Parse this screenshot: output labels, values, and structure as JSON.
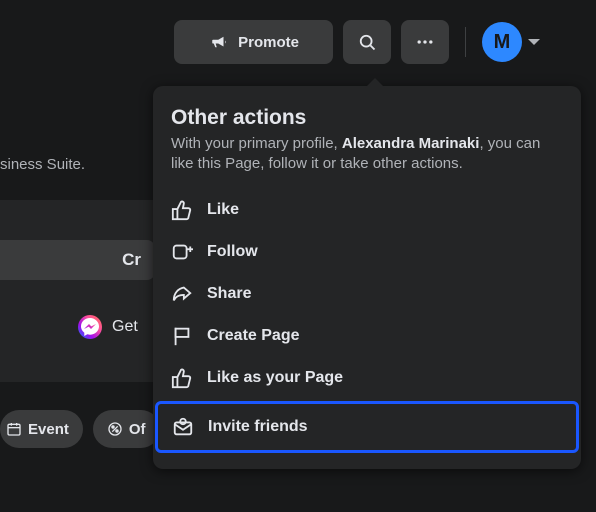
{
  "toolbar": {
    "promote_label": "Promote",
    "avatar_letter": "M"
  },
  "partial": {
    "suite_text": "siness Suite.",
    "center_btn": "Cr",
    "messenger_text": "Get",
    "chip_event": "Event",
    "chip_offers": "Of"
  },
  "dropdown": {
    "title": "Other actions",
    "sub_before": "With your primary profile, ",
    "profile_name": "Alexandra Marinaki",
    "sub_after": ", you can like this Page, follow it or take other actions.",
    "items": [
      {
        "label": "Like",
        "icon": "thumbs-up"
      },
      {
        "label": "Follow",
        "icon": "follow"
      },
      {
        "label": "Share",
        "icon": "share"
      },
      {
        "label": "Create Page",
        "icon": "flag"
      },
      {
        "label": "Like as your Page",
        "icon": "thumbs-up"
      },
      {
        "label": "Invite friends",
        "icon": "invite"
      }
    ]
  }
}
